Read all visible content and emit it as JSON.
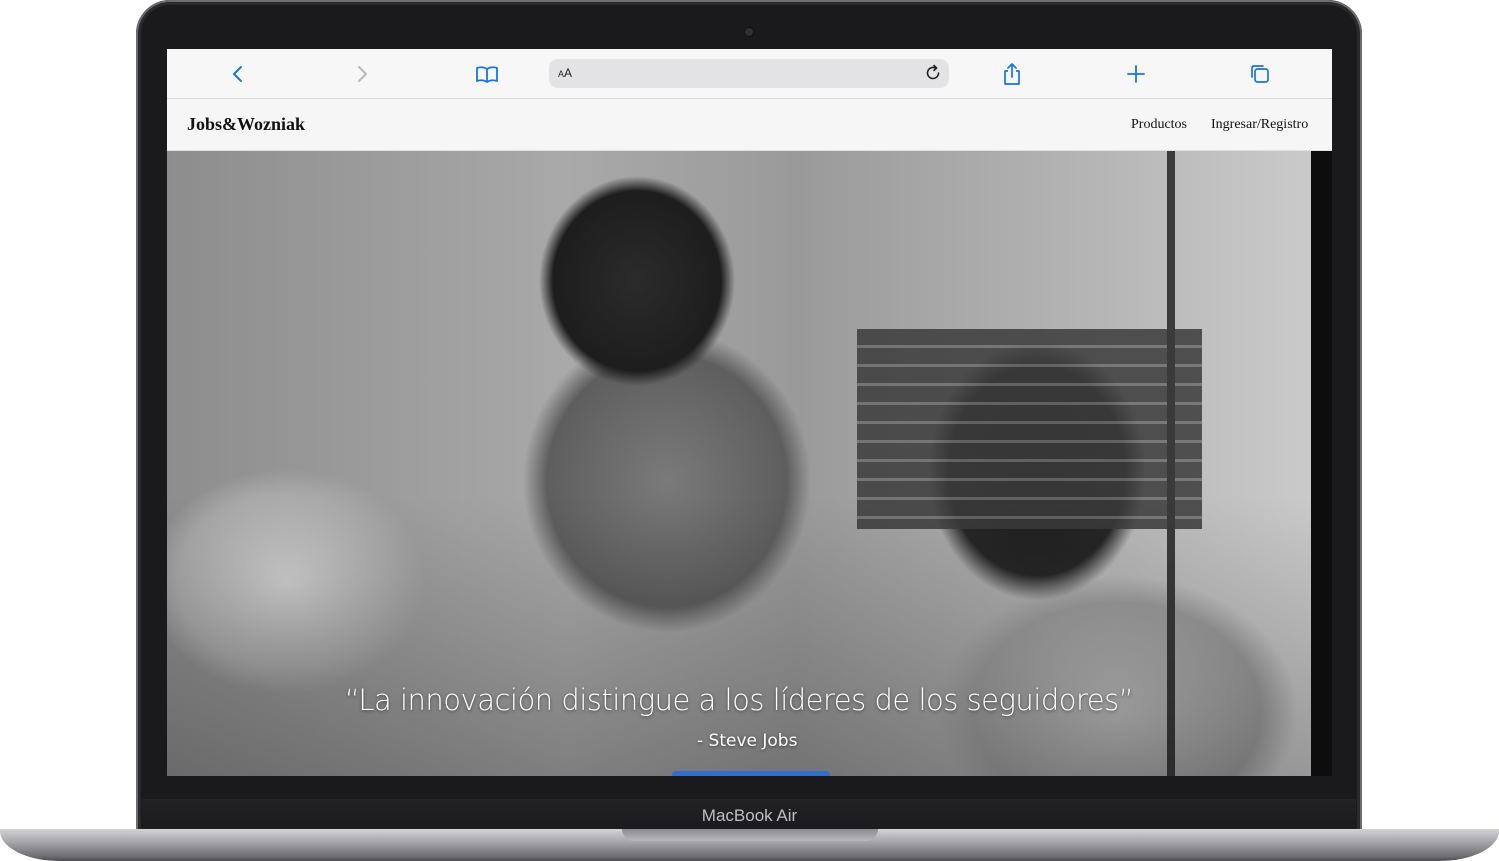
{
  "device": {
    "brand_label": "MacBook Air"
  },
  "browser": {
    "toolbar": {
      "back_icon": "chevron-left-icon",
      "forward_icon": "chevron-right-icon",
      "bookmarks_icon": "open-book-icon",
      "address_text_size_label": "AA",
      "reload_icon": "reload-icon",
      "share_icon": "share-icon",
      "new_tab_icon": "plus-icon",
      "tabs_icon": "tabs-icon",
      "accent_color": "#1a73e8"
    }
  },
  "site": {
    "logo": "Jobs&Wozniak",
    "nav": {
      "products": "Productos",
      "login": "Ingresar/Registro"
    },
    "hero": {
      "quote": "“La innovación distingue a los líderes de los seguidores”",
      "author": "- Steve Jobs",
      "cta_color": "#2f6fd0"
    }
  }
}
